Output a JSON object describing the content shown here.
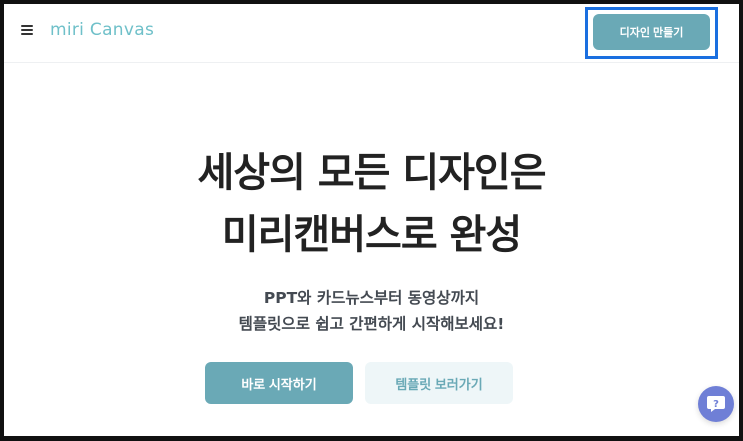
{
  "header": {
    "logo_text": "miri Canvas",
    "create_design_label": "디자인 만들기"
  },
  "hero": {
    "title_line1": "세상의 모든 디자인은",
    "title_line2": "미리캔버스로 완성",
    "subtitle_line1": "PPT와 카드뉴스부터 동영상까지",
    "subtitle_line2": "템플릿으로 쉽고 간편하게 시작해보세요!",
    "start_label": "바로 시작하기",
    "templates_label": "템플릿 보러가기"
  },
  "icons": {
    "menu": "hamburger-menu-icon",
    "help": "help-question-icon"
  },
  "colors": {
    "brand_teal": "#6aa9b6",
    "logo_teal": "#6fc0c9",
    "secondary_bg": "#eef6f8",
    "help_fab": "#6f7fd6",
    "highlight_border": "#1a6fe0"
  }
}
